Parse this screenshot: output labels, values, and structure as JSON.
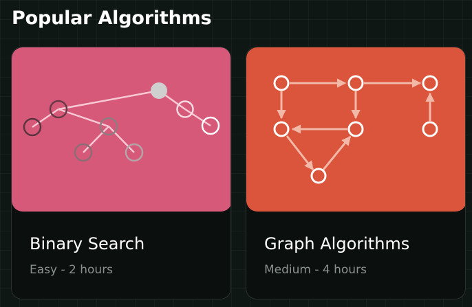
{
  "section": {
    "title": "Popular Algorithms"
  },
  "cards": [
    {
      "title": "Binary Search",
      "meta": "Easy - 2 hours",
      "color": "#d6597a",
      "illustration": "binary-tree-icon"
    },
    {
      "title": "Graph Algorithms",
      "meta": "Medium - 4 hours",
      "color": "#db543c",
      "illustration": "directed-graph-icon"
    }
  ]
}
